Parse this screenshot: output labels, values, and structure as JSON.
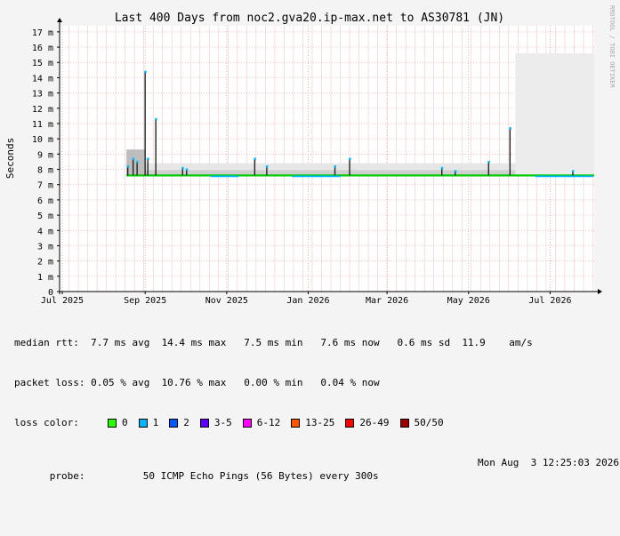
{
  "chart_data": {
    "type": "line",
    "title": "Last 400 Days from noc2.gva20.ip-max.net to AS30781 (JN)",
    "ylabel": "Seconds",
    "watermark": "RRDTOOL / TOBI OETIKER",
    "ylim": [
      0,
      17.4
    ],
    "y_ticks": [
      {
        "value": 0,
        "label": "0"
      },
      {
        "value": 1,
        "label": "1 m"
      },
      {
        "value": 2,
        "label": "2 m"
      },
      {
        "value": 3,
        "label": "3 m"
      },
      {
        "value": 4,
        "label": "4 m"
      },
      {
        "value": 5,
        "label": "5 m"
      },
      {
        "value": 6,
        "label": "6 m"
      },
      {
        "value": 7,
        "label": "7 m"
      },
      {
        "value": 8,
        "label": "8 m"
      },
      {
        "value": 9,
        "label": "9 m"
      },
      {
        "value": 10,
        "label": "10 m"
      },
      {
        "value": 11,
        "label": "11 m"
      },
      {
        "value": 12,
        "label": "12 m"
      },
      {
        "value": 13,
        "label": "13 m"
      },
      {
        "value": 14,
        "label": "14 m"
      },
      {
        "value": 15,
        "label": "15 m"
      },
      {
        "value": 16,
        "label": "16 m"
      },
      {
        "value": 17,
        "label": "17 m"
      }
    ],
    "x_start": "2025-06-29",
    "x_end": "2026-08-03",
    "x_ticks": [
      {
        "date": "2025-07-01",
        "label": "Jul 2025"
      },
      {
        "date": "2025-09-01",
        "label": "Sep 2025"
      },
      {
        "date": "2025-11-01",
        "label": "Nov 2025"
      },
      {
        "date": "2026-01-01",
        "label": "Jan 2026"
      },
      {
        "date": "2026-03-01",
        "label": "Mar 2026"
      },
      {
        "date": "2026-05-01",
        "label": "May 2026"
      },
      {
        "date": "2026-07-01",
        "label": "Jul 2026"
      }
    ],
    "data_start": "2025-08-18",
    "series": [
      {
        "name": "median rtt",
        "color": "#00cc00",
        "baseline": 7.6
      }
    ],
    "spikes": [
      {
        "date": "2025-08-19",
        "value": 8.2
      },
      {
        "date": "2025-08-23",
        "value": 8.7
      },
      {
        "date": "2025-08-26",
        "value": 8.5
      },
      {
        "date": "2025-09-01",
        "value": 14.4
      },
      {
        "date": "2025-09-03",
        "value": 8.7
      },
      {
        "date": "2025-09-09",
        "value": 11.3
      },
      {
        "date": "2025-09-29",
        "value": 8.1
      },
      {
        "date": "2025-10-02",
        "value": 8.0
      },
      {
        "date": "2025-11-22",
        "value": 8.7
      },
      {
        "date": "2025-12-01",
        "value": 8.2
      },
      {
        "date": "2026-01-21",
        "value": 8.2
      },
      {
        "date": "2026-02-01",
        "value": 8.7
      },
      {
        "date": "2026-04-11",
        "value": 8.1
      },
      {
        "date": "2026-04-21",
        "value": 7.9
      },
      {
        "date": "2026-05-16",
        "value": 8.5
      },
      {
        "date": "2026-06-01",
        "value": 10.7
      },
      {
        "date": "2026-07-18",
        "value": 7.9
      }
    ],
    "smoke_max": 17.4,
    "grid": true
  },
  "legend": {
    "rows": [
      "median rtt:  7.7 ms avg  14.4 ms max   7.5 ms min   7.6 ms now   0.6 ms sd  11.9    am/s",
      "packet loss: 0.05 % avg  10.76 % max   0.00 % min   0.04 % now"
    ],
    "loss_label": "loss color:",
    "loss_items": [
      {
        "label": "0",
        "color": "#26ff00"
      },
      {
        "label": "1",
        "color": "#00b8ff"
      },
      {
        "label": "2",
        "color": "#0059ff"
      },
      {
        "label": "3-5",
        "color": "#5e00ff"
      },
      {
        "label": "6-12",
        "color": "#ff00ff"
      },
      {
        "label": "13-25",
        "color": "#ff5500"
      },
      {
        "label": "26-49",
        "color": "#ff0000"
      },
      {
        "label": "50/50",
        "color": "#a10000"
      }
    ],
    "probe_label": "probe:",
    "probe_text": "50 ICMP Echo Pings (56 Bytes) every 300s",
    "timestamp": "Mon Aug  3 12:25:03 2026"
  }
}
